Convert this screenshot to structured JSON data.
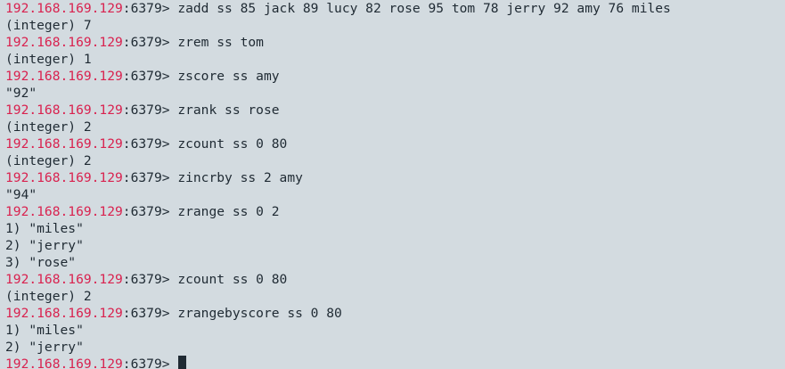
{
  "prompt": {
    "host": "192.168.169.129",
    "port_suffix": ":6379> "
  },
  "colors": {
    "background": "#d3dbe0",
    "host": "#d9224f",
    "text": "#1f2a33"
  },
  "lines": [
    {
      "type": "command",
      "text": "zadd ss 85 jack 89 lucy 82 rose 95 tom 78 jerry 92 amy 76 miles"
    },
    {
      "type": "output",
      "text": "(integer) 7"
    },
    {
      "type": "command",
      "text": "zrem ss tom"
    },
    {
      "type": "output",
      "text": "(integer) 1"
    },
    {
      "type": "command",
      "text": "zscore ss amy"
    },
    {
      "type": "output",
      "text": "\"92\""
    },
    {
      "type": "command",
      "text": "zrank ss rose"
    },
    {
      "type": "output",
      "text": "(integer) 2"
    },
    {
      "type": "command",
      "text": "zcount ss 0 80"
    },
    {
      "type": "output",
      "text": "(integer) 2"
    },
    {
      "type": "command",
      "text": "zincrby ss 2 amy"
    },
    {
      "type": "output",
      "text": "\"94\""
    },
    {
      "type": "command",
      "text": "zrange ss 0 2"
    },
    {
      "type": "output",
      "text": "1) \"miles\""
    },
    {
      "type": "output",
      "text": "2) \"jerry\""
    },
    {
      "type": "output",
      "text": "3) \"rose\""
    },
    {
      "type": "command",
      "text": "zcount ss 0 80"
    },
    {
      "type": "output",
      "text": "(integer) 2"
    },
    {
      "type": "command",
      "text": "zrangebyscore ss 0 80"
    },
    {
      "type": "output",
      "text": "1) \"miles\""
    },
    {
      "type": "output",
      "text": "2) \"jerry\""
    },
    {
      "type": "active-prompt",
      "text": ""
    }
  ]
}
